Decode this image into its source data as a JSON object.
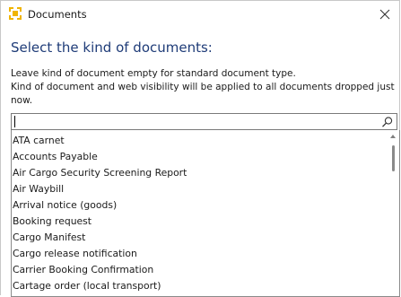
{
  "window": {
    "title": "Documents",
    "accent_color": "#f0b400",
    "heading_color": "#1f3c78",
    "icons": {
      "app": "app-logo-icon",
      "close": "close-icon",
      "search": "search-icon",
      "scroll_up": "chevron-up-icon"
    }
  },
  "dialog": {
    "heading": "Select the kind of documents:",
    "instruction_line1": "Leave kind of document empty for standard document type.",
    "instruction_line2": "Kind of document and web visibility will be applied to all documents dropped just",
    "instruction_line3": "now."
  },
  "combo": {
    "value": "",
    "placeholder": ""
  },
  "list": {
    "items": [
      "ATA carnet",
      "Accounts Payable",
      "Air Cargo Security Screening Report",
      "Air Waybill",
      "Arrival notice (goods)",
      "Booking request",
      "Cargo Manifest",
      "Cargo release notification",
      "Carrier Booking Confirmation",
      "Cartage order (local transport)"
    ]
  }
}
